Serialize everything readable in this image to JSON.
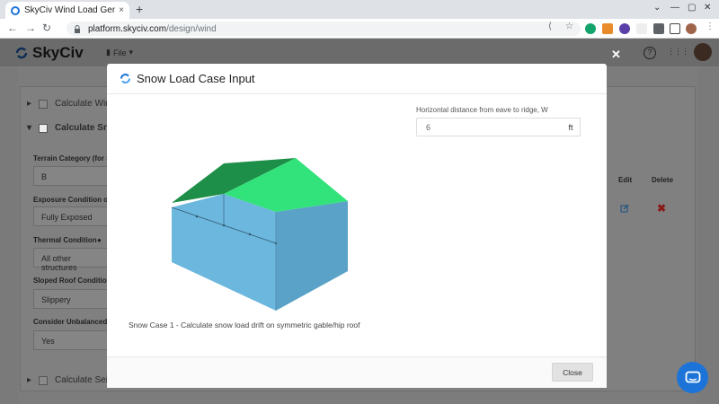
{
  "browser": {
    "tab_title": "SkyCiv Wind Load Genera",
    "tab_close": "×",
    "new_tab": "+",
    "url_host": "platform.skyciv.com",
    "url_path": "/design/wind",
    "win_min": "⌄",
    "win_min2": "—",
    "win_restore": "▢",
    "win_close": "✕",
    "back": "←",
    "forward": "→",
    "reload": "↻",
    "share_icon": "⟨",
    "star_icon": "☆",
    "menu_icon": "⋮"
  },
  "app": {
    "logo_text": "SkyCiv",
    "file_menu": "File",
    "help_icon": "?",
    "apps_icon": "⋮⋮⋮"
  },
  "background": {
    "calc_wind": "Calculate Wind",
    "calc_snow": "Calculate Snow",
    "calc_seismic": "Calculate Seism",
    "terrain_label": "Terrain Category (for S",
    "terrain_value": "B",
    "exposure_label": "Exposure Condition of",
    "exposure_value": "Fully Exposed",
    "thermal_label": "Thermal Condition",
    "thermal_value": "All other structures",
    "sloped_label": "Sloped Roof Condition",
    "sloped_value": "Slippery",
    "unbalanced_label": "Consider Unbalanced",
    "unbalanced_value": "Yes",
    "table_edit": "Edit",
    "table_delete": "Delete",
    "delete_icon": "✖"
  },
  "modal": {
    "title": "Snow Load Case Input",
    "close_x": "✕",
    "field_label": "Horizontal distance from eave to ridge, W",
    "field_value": "6",
    "field_unit": "ft",
    "caption": "Snow Case 1 - Calculate snow load drift on symmetric gable/hip roof",
    "close_button": "Close"
  },
  "colors": {
    "brand_blue": "#1d74d8",
    "roof_light": "#32e27a",
    "roof_dark": "#1e8f48",
    "wall_front": "#6cb7de",
    "wall_side": "#5aa2c7"
  }
}
